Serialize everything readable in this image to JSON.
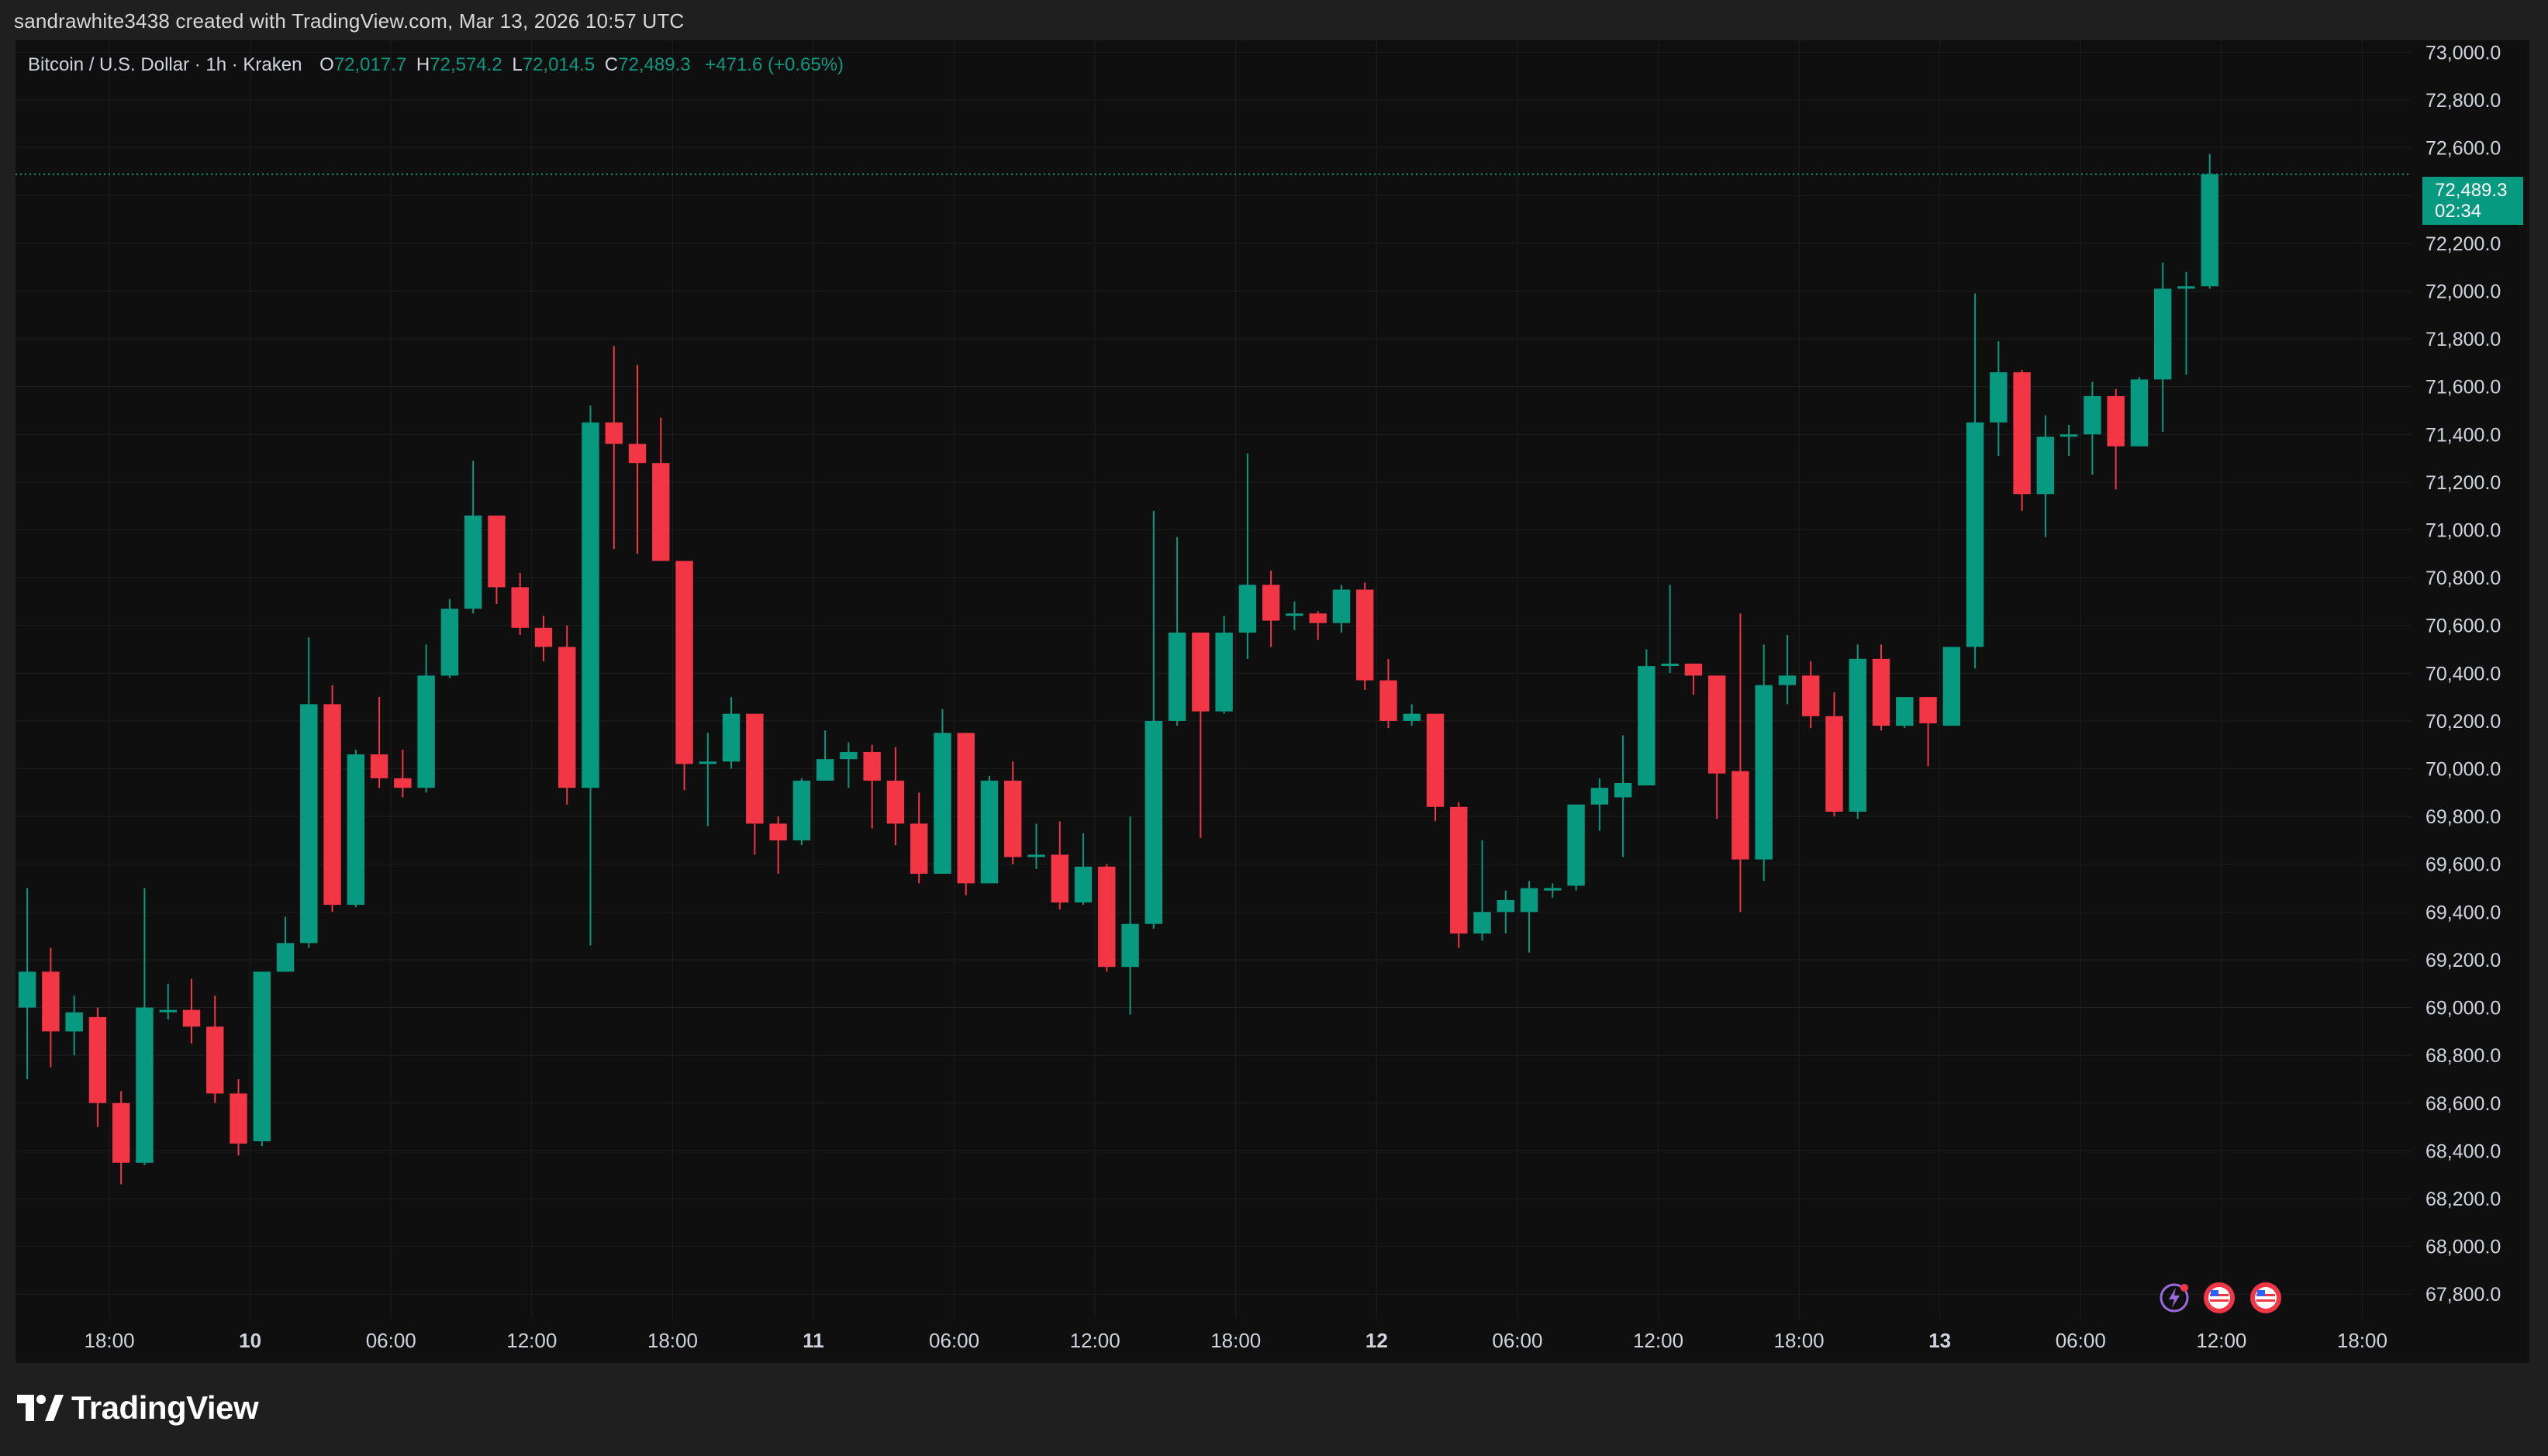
{
  "header": {
    "attribution": "sandrawhite3438 created with TradingView.com, Mar 13, 2026 10:57 UTC"
  },
  "legend": {
    "symbol": "Bitcoin / U.S. Dollar · 1h · Kraken",
    "open_label": "O",
    "open": "72,017.7",
    "high_label": "H",
    "high": "72,574.2",
    "low_label": "L",
    "low": "72,014.5",
    "close_label": "C",
    "close": "72,489.3",
    "change": "+471.6 (+0.65%)"
  },
  "price_tag": {
    "price": "72,489.3",
    "countdown": "02:34"
  },
  "footer": {
    "brand": "TradingView"
  },
  "colors": {
    "up": "#089981",
    "down": "#F23645",
    "background": "#0f0f0f",
    "frame": "#1f1f1f",
    "grid": "#1e1e1e",
    "text": "#d1d4dc"
  },
  "chart_data": {
    "type": "candlestick",
    "title": "Bitcoin / U.S. Dollar · 1h · Kraken",
    "ylim": [
      67700,
      73050
    ],
    "y_ticks": [
      67800,
      68000,
      68200,
      68400,
      68600,
      68800,
      69000,
      69200,
      69400,
      69600,
      69800,
      70000,
      70200,
      70400,
      70600,
      70800,
      71000,
      71200,
      71400,
      71600,
      71800,
      72000,
      72200,
      72400,
      72600,
      72800,
      73000
    ],
    "y_tick_labels": [
      "67,800.0",
      "68,000.0",
      "68,200.0",
      "68,400.0",
      "68,600.0",
      "68,800.0",
      "69,000.0",
      "69,200.0",
      "69,400.0",
      "69,600.0",
      "69,800.0",
      "70,000.0",
      "70,200.0",
      "70,400.0",
      "70,600.0",
      "70,800.0",
      "71,000.0",
      "71,200.0",
      "71,400.0",
      "71,600.0",
      "71,800.0",
      "72,000.0",
      "72,200.0",
      "72,400.0",
      "72,600.0",
      "72,800.0",
      "73,000.0"
    ],
    "x_ticks": [
      {
        "index": 3.5,
        "label": "18:00",
        "bold": false
      },
      {
        "index": 9.5,
        "label": "10",
        "bold": true
      },
      {
        "index": 15.5,
        "label": "06:00",
        "bold": false
      },
      {
        "index": 21.5,
        "label": "12:00",
        "bold": false
      },
      {
        "index": 27.5,
        "label": "18:00",
        "bold": false
      },
      {
        "index": 33.5,
        "label": "11",
        "bold": true
      },
      {
        "index": 39.5,
        "label": "06:00",
        "bold": false
      },
      {
        "index": 45.5,
        "label": "12:00",
        "bold": false
      },
      {
        "index": 51.5,
        "label": "18:00",
        "bold": false
      },
      {
        "index": 57.5,
        "label": "12",
        "bold": true
      },
      {
        "index": 63.5,
        "label": "06:00",
        "bold": false
      },
      {
        "index": 69.5,
        "label": "12:00",
        "bold": false
      },
      {
        "index": 75.5,
        "label": "18:00",
        "bold": false
      },
      {
        "index": 81.5,
        "label": "13",
        "bold": true
      },
      {
        "index": 87.5,
        "label": "06:00",
        "bold": false
      },
      {
        "index": 93.5,
        "label": "12:00",
        "bold": false
      },
      {
        "index": 99.5,
        "label": "18:00",
        "bold": false
      }
    ],
    "x_range": [
      -0.5,
      101.6
    ],
    "current_price": 72489.3,
    "candles": [
      [
        69000,
        69150,
        68700,
        69500
      ],
      [
        69150,
        68900,
        68750,
        69250
      ],
      [
        68900,
        68980,
        68800,
        69050
      ],
      [
        68960,
        68600,
        68500,
        69000
      ],
      [
        68600,
        68350,
        68260,
        68650
      ],
      [
        68350,
        69000,
        68340,
        69500
      ],
      [
        68990,
        68990,
        68950,
        69100
      ],
      [
        68990,
        68920,
        68850,
        69120
      ],
      [
        68920,
        68640,
        68600,
        69050
      ],
      [
        68640,
        68430,
        68380,
        68700
      ],
      [
        68440,
        69150,
        68420,
        69150
      ],
      [
        69150,
        69270,
        69150,
        69380
      ],
      [
        69270,
        70270,
        69250,
        70550
      ],
      [
        70270,
        69430,
        69400,
        70350
      ],
      [
        69430,
        70060,
        69420,
        70080
      ],
      [
        70060,
        69960,
        69920,
        70300
      ],
      [
        69960,
        69920,
        69880,
        70080
      ],
      [
        69920,
        70390,
        69900,
        70520
      ],
      [
        70390,
        70670,
        70380,
        70710
      ],
      [
        70670,
        71060,
        70650,
        71290
      ],
      [
        71060,
        70760,
        70690,
        71060
      ],
      [
        70760,
        70590,
        70560,
        70820
      ],
      [
        70590,
        70510,
        70450,
        70640
      ],
      [
        70510,
        69920,
        69850,
        70600
      ],
      [
        69920,
        71450,
        69260,
        71520
      ],
      [
        71450,
        71360,
        70920,
        71770
      ],
      [
        71360,
        71280,
        70900,
        71690
      ],
      [
        71280,
        70870,
        70870,
        71470
      ],
      [
        70870,
        70020,
        69910,
        70870
      ],
      [
        70020,
        70030,
        69760,
        70150
      ],
      [
        70030,
        70230,
        70000,
        70300
      ],
      [
        70230,
        69770,
        69640,
        70230
      ],
      [
        69770,
        69700,
        69560,
        69800
      ],
      [
        69700,
        69950,
        69680,
        69960
      ],
      [
        69950,
        70040,
        69950,
        70160
      ],
      [
        70040,
        70070,
        69920,
        70110
      ],
      [
        70070,
        69950,
        69750,
        70100
      ],
      [
        69950,
        69770,
        69680,
        70090
      ],
      [
        69770,
        69560,
        69520,
        69900
      ],
      [
        69560,
        70150,
        69560,
        70250
      ],
      [
        70150,
        69520,
        69470,
        70150
      ],
      [
        69520,
        69950,
        69520,
        69970
      ],
      [
        69950,
        69630,
        69600,
        70030
      ],
      [
        69630,
        69640,
        69580,
        69770
      ],
      [
        69640,
        69440,
        69410,
        69780
      ],
      [
        69440,
        69590,
        69430,
        69730
      ],
      [
        69590,
        69170,
        69150,
        69600
      ],
      [
        69170,
        69350,
        68970,
        69800
      ],
      [
        69350,
        70200,
        69330,
        71080
      ],
      [
        70200,
        70570,
        70180,
        70970
      ],
      [
        70570,
        70240,
        69710,
        70570
      ],
      [
        70240,
        70570,
        70230,
        70640
      ],
      [
        70570,
        70770,
        70460,
        71320
      ],
      [
        70770,
        70620,
        70510,
        70830
      ],
      [
        70640,
        70650,
        70580,
        70700
      ],
      [
        70650,
        70610,
        70540,
        70660
      ],
      [
        70610,
        70750,
        70570,
        70770
      ],
      [
        70750,
        70370,
        70330,
        70780
      ],
      [
        70370,
        70200,
        70170,
        70460
      ],
      [
        70200,
        70230,
        70180,
        70270
      ],
      [
        70230,
        69840,
        69780,
        70230
      ],
      [
        69840,
        69310,
        69250,
        69860
      ],
      [
        69310,
        69400,
        69280,
        69700
      ],
      [
        69400,
        69450,
        69310,
        69490
      ],
      [
        69400,
        69500,
        69230,
        69530
      ],
      [
        69490,
        69500,
        69460,
        69520
      ],
      [
        69510,
        69850,
        69490,
        69850
      ],
      [
        69850,
        69920,
        69740,
        69960
      ],
      [
        69880,
        69940,
        69630,
        70140
      ],
      [
        69930,
        70430,
        69940,
        70500
      ],
      [
        70430,
        70440,
        70400,
        70770
      ],
      [
        70440,
        70390,
        70310,
        70440
      ],
      [
        70390,
        69980,
        69790,
        70390
      ],
      [
        69990,
        69620,
        69400,
        70650
      ],
      [
        69620,
        70350,
        69530,
        70520
      ],
      [
        70350,
        70390,
        70270,
        70560
      ],
      [
        70390,
        70220,
        70170,
        70450
      ],
      [
        70220,
        69820,
        69800,
        70320
      ],
      [
        69820,
        70460,
        69790,
        70520
      ],
      [
        70460,
        70180,
        70160,
        70520
      ],
      [
        70180,
        70300,
        70170,
        70300
      ],
      [
        70300,
        70190,
        70010,
        70300
      ],
      [
        70180,
        70510,
        70180,
        70510
      ],
      [
        70510,
        71450,
        70420,
        71990
      ],
      [
        71450,
        71660,
        71310,
        71790
      ],
      [
        71660,
        71150,
        71080,
        71670
      ],
      [
        71150,
        71390,
        70970,
        71480
      ],
      [
        71390,
        71400,
        71310,
        71440
      ],
      [
        71400,
        71560,
        71230,
        71620
      ],
      [
        71560,
        71350,
        71170,
        71590
      ],
      [
        71350,
        71630,
        71350,
        71640
      ],
      [
        71630,
        72010,
        71410,
        72120
      ],
      [
        72010,
        72020,
        71650,
        72080
      ],
      [
        72020,
        72489.3,
        72010,
        72574.2
      ]
    ]
  }
}
